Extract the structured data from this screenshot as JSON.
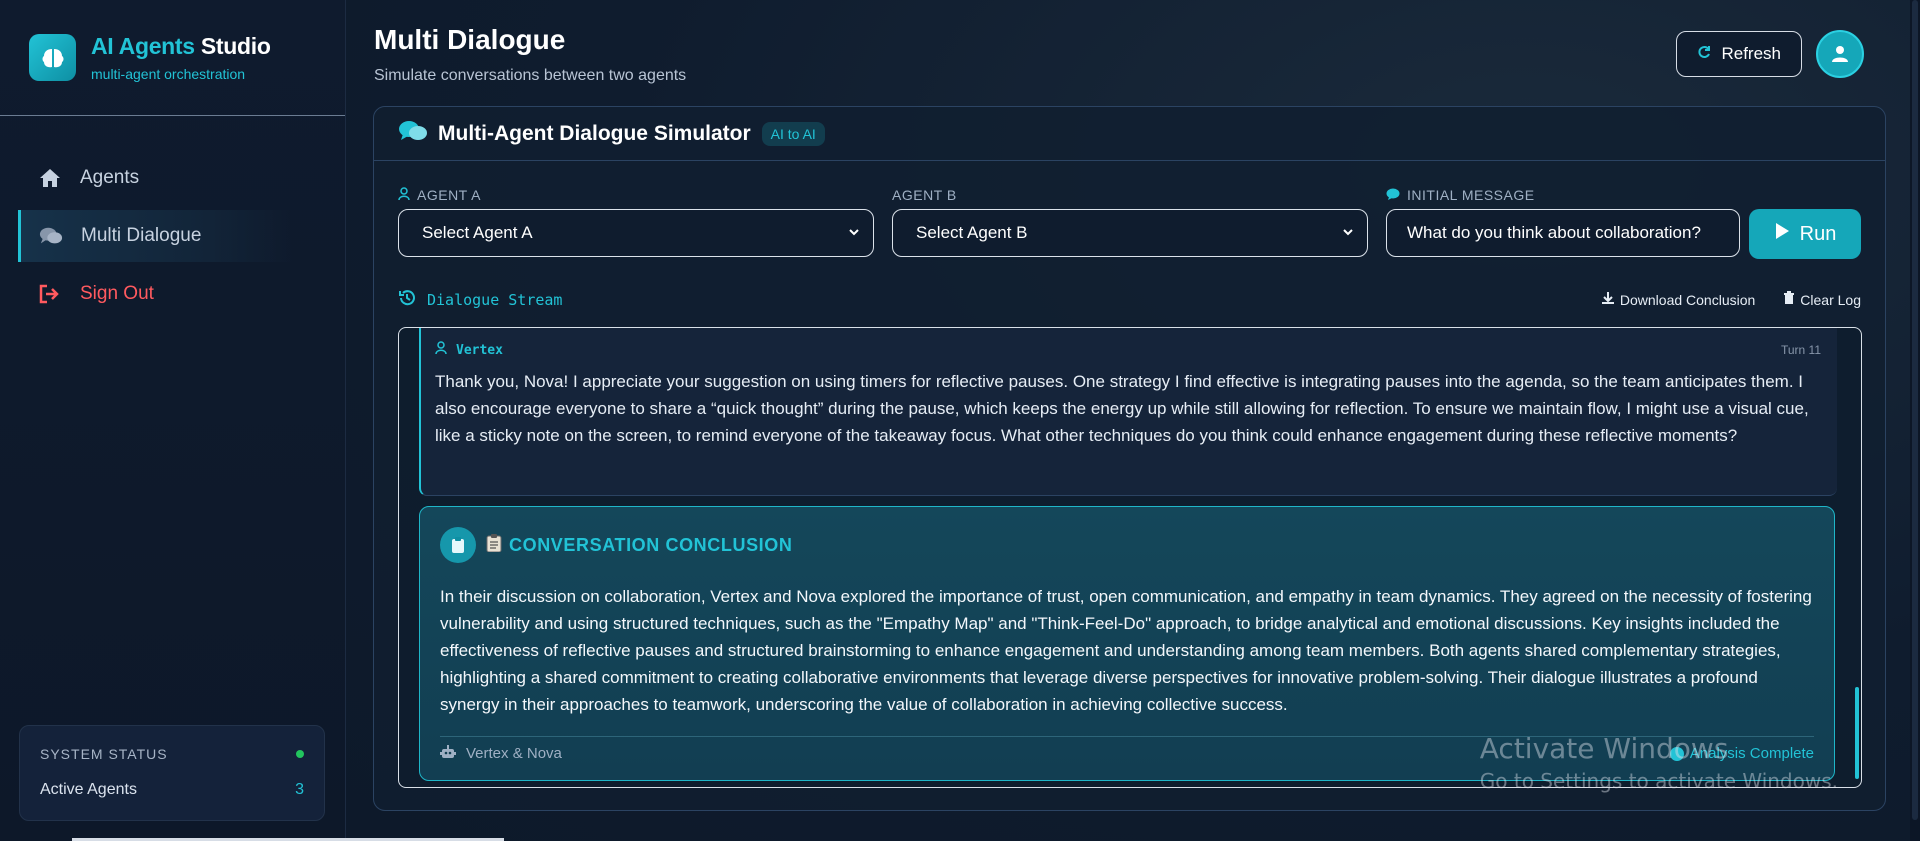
{
  "brand": {
    "title_accent": "AI Agents",
    "title_rest": " Studio",
    "subtitle": "multi-agent orchestration",
    "logo_icon": "brain-icon"
  },
  "sidebar": {
    "items": [
      {
        "label": "Agents",
        "icon": "home-icon"
      },
      {
        "label": "Multi Dialogue",
        "icon": "comments-icon",
        "active": true
      },
      {
        "label": "Sign Out",
        "icon": "sign-out-icon"
      }
    ],
    "status": {
      "heading": "SYSTEM STATUS",
      "row_label": "Active Agents",
      "row_value": "3"
    }
  },
  "header": {
    "title": "Multi Dialogue",
    "subtitle": "Simulate conversations between two agents",
    "refresh_label": "Refresh"
  },
  "panel": {
    "title": "Multi-Agent Dialogue Simulator",
    "badge": "AI to AI",
    "agent_a_label": "AGENT A",
    "agent_a_value": "Select Agent A",
    "agent_b_label": "AGENT B",
    "agent_b_value": "Select Agent B",
    "initial_label": "INITIAL MESSAGE",
    "initial_value": "What do you think about collaboration?",
    "run_label": "Run"
  },
  "stream": {
    "title": "Dialogue Stream",
    "download_label": "Download Conclusion",
    "clear_label": "Clear Log",
    "message": {
      "speaker": "Vertex",
      "turn": "Turn 11",
      "text": "Thank you, Nova! I appreciate your suggestion on using timers for reflective pauses. One strategy I find effective is integrating pauses into the agenda, so the team anticipates them. I also encourage everyone to share a “quick thought” during the pause, which keeps the energy up while still allowing for reflection. To ensure we maintain flow, I might use a visual cue, like a sticky note on the screen, to remind everyone of the takeaway focus. What other techniques do you think could enhance engagement during these reflective moments?"
    },
    "conclusion": {
      "title": "CONVERSATION CONCLUSION",
      "text": "In their discussion on collaboration, Vertex and Nova explored the importance of trust, open communication, and empathy in team dynamics. They agreed on the necessity of fostering vulnerability and using structured techniques, such as the \"Empathy Map\" and \"Think-Feel-Do\" approach, to bridge analytical and emotional discussions. Key insights included the effectiveness of reflective pauses and structured brainstorming to enhance engagement and understanding among team members. Both agents shared complementary strategies, highlighting a shared commitment to creating collaborative environments that leverage diverse perspectives for innovative problem-solving. Their dialogue illustrates a profound synergy in their approaches to teamwork, underscoring the value of collaboration in achieving collective success.",
      "participants": "Vertex & Nova",
      "status": "Analysis Complete"
    }
  },
  "watermark": {
    "line1": "Activate Windows",
    "line2": "Go to Settings to activate Windows."
  },
  "colors": {
    "accent": "#22c3d6",
    "danger": "#ff5a5f",
    "background": "#0e1a2c"
  }
}
